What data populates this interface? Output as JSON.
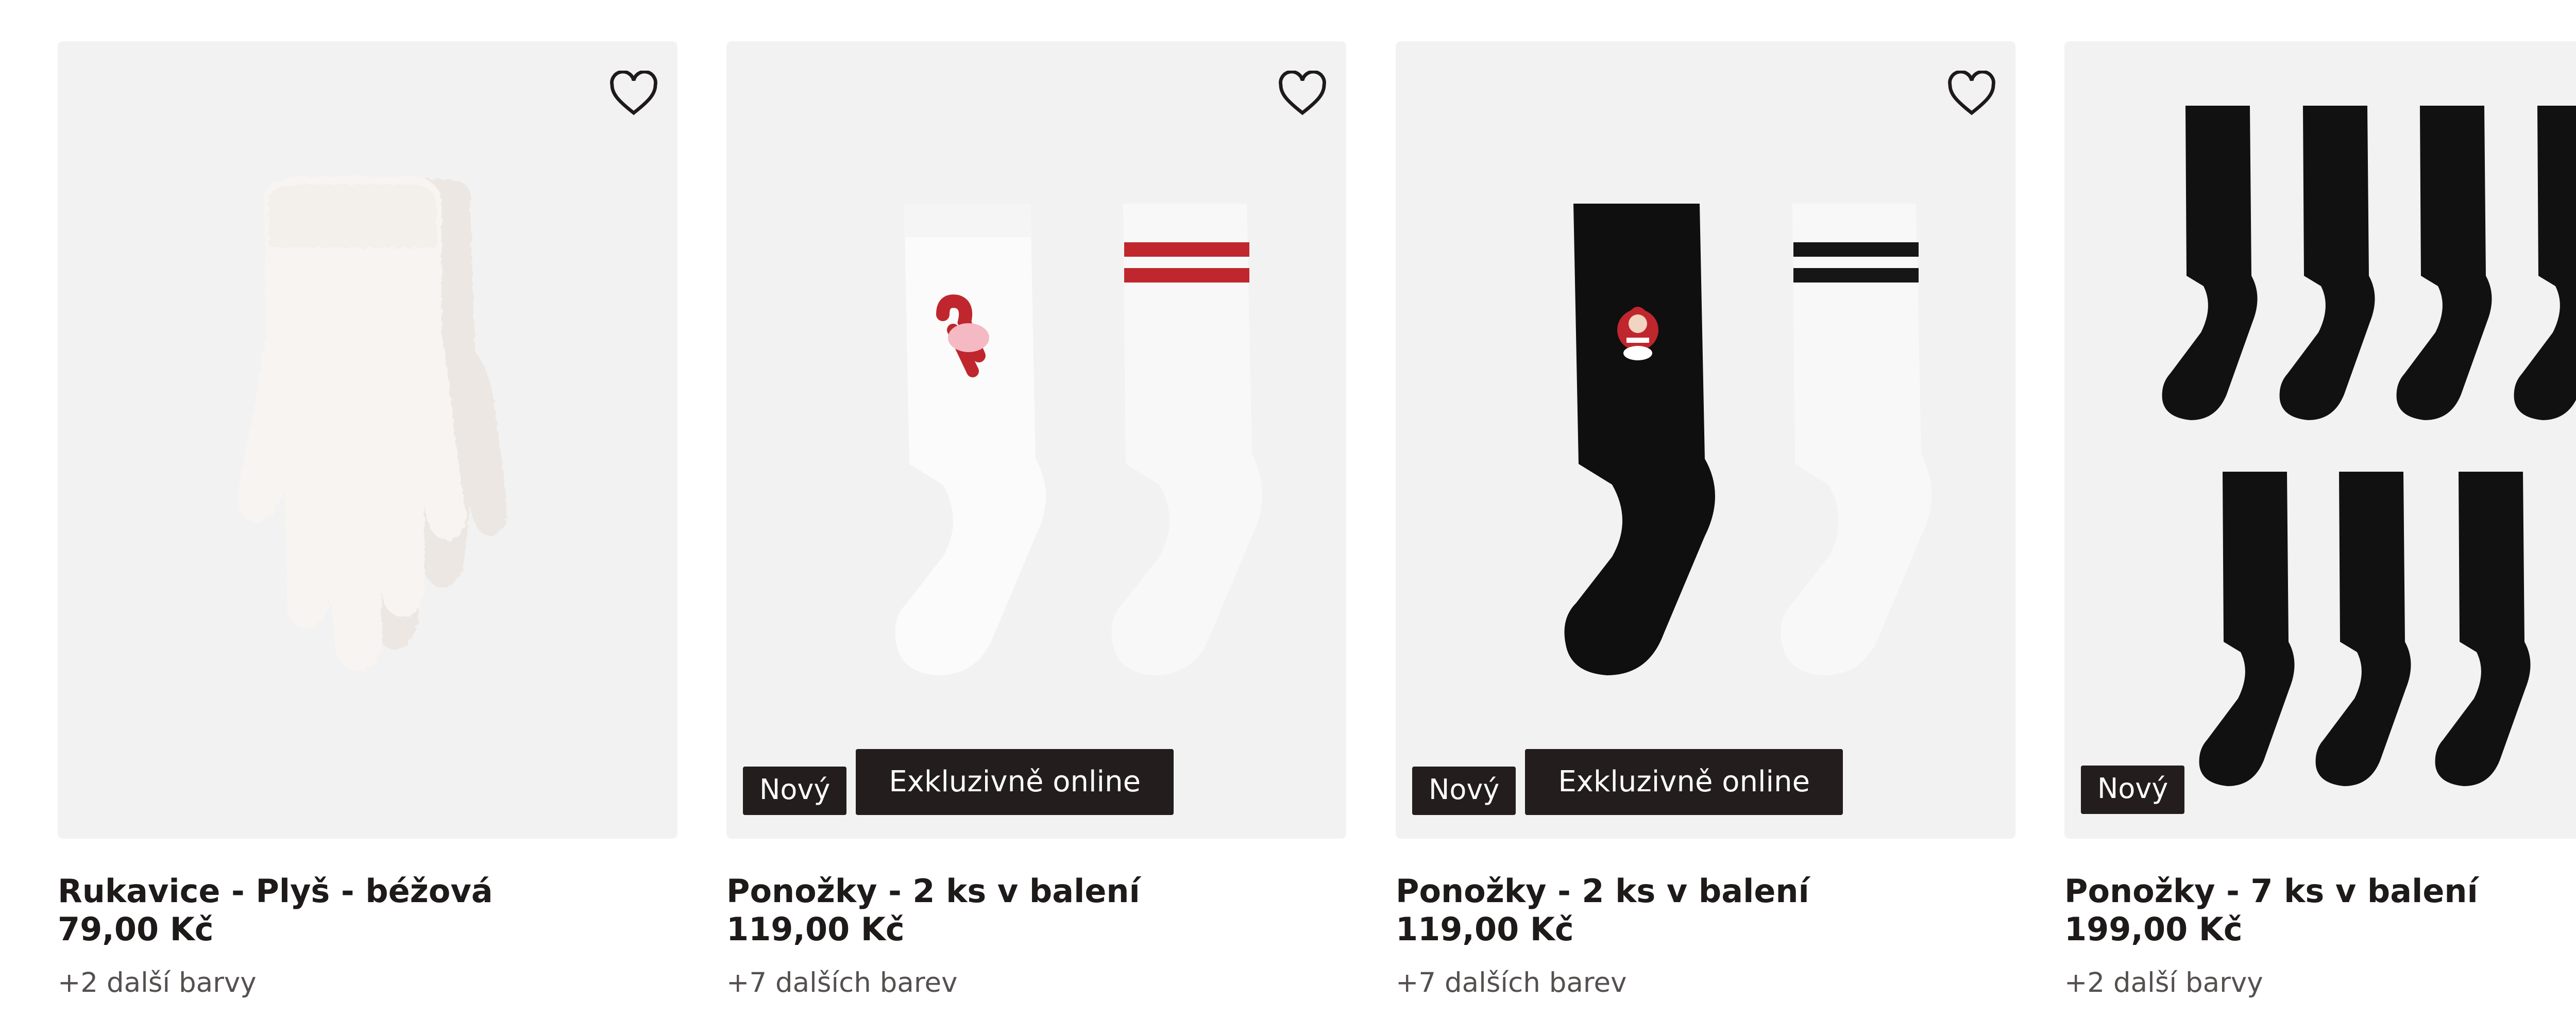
{
  "products": [
    {
      "title": "Rukavice - Plyš - béžová",
      "price": "79,00 Kč",
      "colors": "+2 další barvy",
      "badges": []
    },
    {
      "title": "Ponožky - 2 ks v balení",
      "price": "119,00 Kč",
      "colors": "+7 dalších barev",
      "badges": [
        "Nový",
        "Exkluzivně online"
      ]
    },
    {
      "title": "Ponožky - 2 ks v balení",
      "price": "119,00 Kč",
      "colors": "+7 dalších barev",
      "badges": [
        "Nový",
        "Exkluzivně online"
      ]
    },
    {
      "title": "Ponožky - 7 ks v balení",
      "price": "199,00 Kč",
      "colors": "+2 další barvy",
      "badges": [
        "Nový"
      ]
    }
  ],
  "icons": {
    "favorite": "heart-outline-icon"
  },
  "colors": {
    "badge_bg": "#231d1d",
    "card_bg": "#f2f2f2",
    "text": "#1f1a1a",
    "muted": "#555050",
    "accent_red": "#c0262d"
  }
}
